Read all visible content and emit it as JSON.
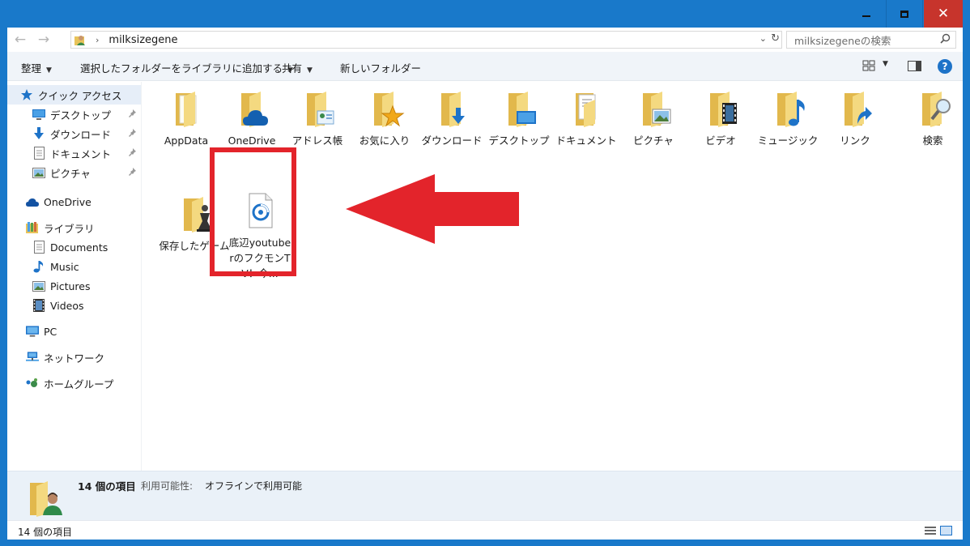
{
  "window": {
    "minimize_glyph": "",
    "close_glyph": "✕"
  },
  "address": {
    "back_glyph": "←",
    "forward_glyph": "→",
    "up_glyph": "⌃",
    "separator": "›",
    "path": "milksizegene",
    "dropdown_glyph": "⌄",
    "refresh_glyph": "↻"
  },
  "search": {
    "placeholder": "milksizegeneの検索",
    "icon_glyph": "⚲"
  },
  "toolbar": {
    "organize": "整理",
    "add_to_library": "選択したフォルダーをライブラリに追加する",
    "share": "共有",
    "new_folder": "新しいフォルダー",
    "caret": "▼",
    "help": "?"
  },
  "sidebar": {
    "items": [
      {
        "label": "クイック アクセス",
        "icon": "star-icon"
      },
      {
        "label": "デスクトップ",
        "icon": "desktop-icon",
        "pinned": true
      },
      {
        "label": "ダウンロード",
        "icon": "download-icon",
        "pinned": true
      },
      {
        "label": "ドキュメント",
        "icon": "document-icon",
        "pinned": true
      },
      {
        "label": "ピクチャ",
        "icon": "picture-icon",
        "pinned": true
      },
      {
        "label": "OneDrive",
        "icon": "cloud-icon"
      },
      {
        "label": "ライブラリ",
        "icon": "library-icon"
      },
      {
        "label": "Documents",
        "icon": "document-icon"
      },
      {
        "label": "Music",
        "icon": "music-icon"
      },
      {
        "label": "Pictures",
        "icon": "picture-icon"
      },
      {
        "label": "Videos",
        "icon": "video-icon"
      },
      {
        "label": "PC",
        "icon": "computer-icon"
      },
      {
        "label": "ネットワーク",
        "icon": "network-icon"
      },
      {
        "label": "ホームグループ",
        "icon": "homegroup-icon"
      }
    ],
    "pin_glyph": "📌"
  },
  "files": [
    {
      "label": "AppData",
      "overlay": "none"
    },
    {
      "label": "OneDrive",
      "overlay": "cloud"
    },
    {
      "label": "アドレス帳",
      "overlay": "contact"
    },
    {
      "label": "お気に入り",
      "overlay": "star"
    },
    {
      "label": "ダウンロード",
      "overlay": "download"
    },
    {
      "label": "デスクトップ",
      "overlay": "desktop"
    },
    {
      "label": "ドキュメント",
      "overlay": "document"
    },
    {
      "label": "ピクチャ",
      "overlay": "picture"
    },
    {
      "label": "ビデオ",
      "overlay": "video"
    },
    {
      "label": "ミュージック",
      "overlay": "music"
    },
    {
      "label": "リンク",
      "overlay": "link"
    },
    {
      "label": "検索",
      "overlay": "search"
    },
    {
      "label": "保存したゲーム",
      "overlay": "game"
    },
    {
      "label": "底辺youtuberのフクモンTV！今...",
      "overlay": "media-file"
    }
  ],
  "details": {
    "count": "14 個の項目",
    "availability_label": "利用可能性:",
    "availability_value": "オフラインで利用可能"
  },
  "status": {
    "text": "14 個の項目"
  },
  "colors": {
    "frame": "#1979ca",
    "close_button": "#c7342c",
    "highlight": "#e3242b",
    "folder": "#f3d77b"
  }
}
